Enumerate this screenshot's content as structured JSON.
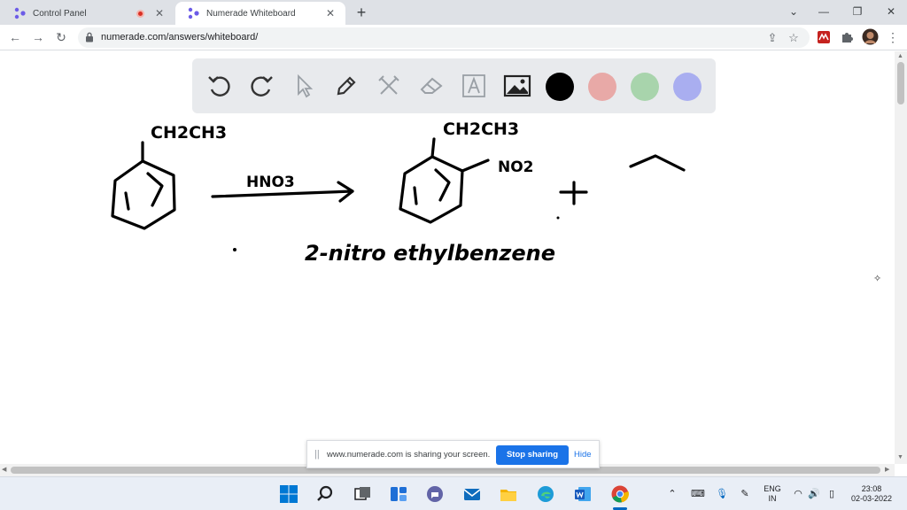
{
  "browser": {
    "tabs": [
      {
        "title": "Control Panel",
        "recording": true
      },
      {
        "title": "Numerade Whiteboard",
        "active": true
      }
    ],
    "url": "numerade.com/answers/whiteboard/"
  },
  "whiteboard": {
    "tools": [
      "undo-icon",
      "redo-icon",
      "pointer-icon",
      "pen-icon",
      "tools-icon",
      "eraser-icon",
      "text-icon",
      "image-icon"
    ],
    "colors": [
      "#000000",
      "#e8a9a7",
      "#a8d4ac",
      "#a9aef0"
    ],
    "handwriting": {
      "reactant_substituent": "CH2CH3",
      "reagent": "HNO3",
      "product_substituent_1": "CH2CH3",
      "product_substituent_2": "NO2",
      "plus": "+",
      "product_name": "2-nitro ethylbenzene"
    }
  },
  "share_bar": {
    "grip": "||",
    "message": "www.numerade.com is sharing your screen.",
    "stop_label": "Stop sharing",
    "hide_label": "Hide"
  },
  "taskbar": {
    "language": "ENG",
    "region": "IN",
    "time": "23:08",
    "date": "02-03-2022"
  }
}
